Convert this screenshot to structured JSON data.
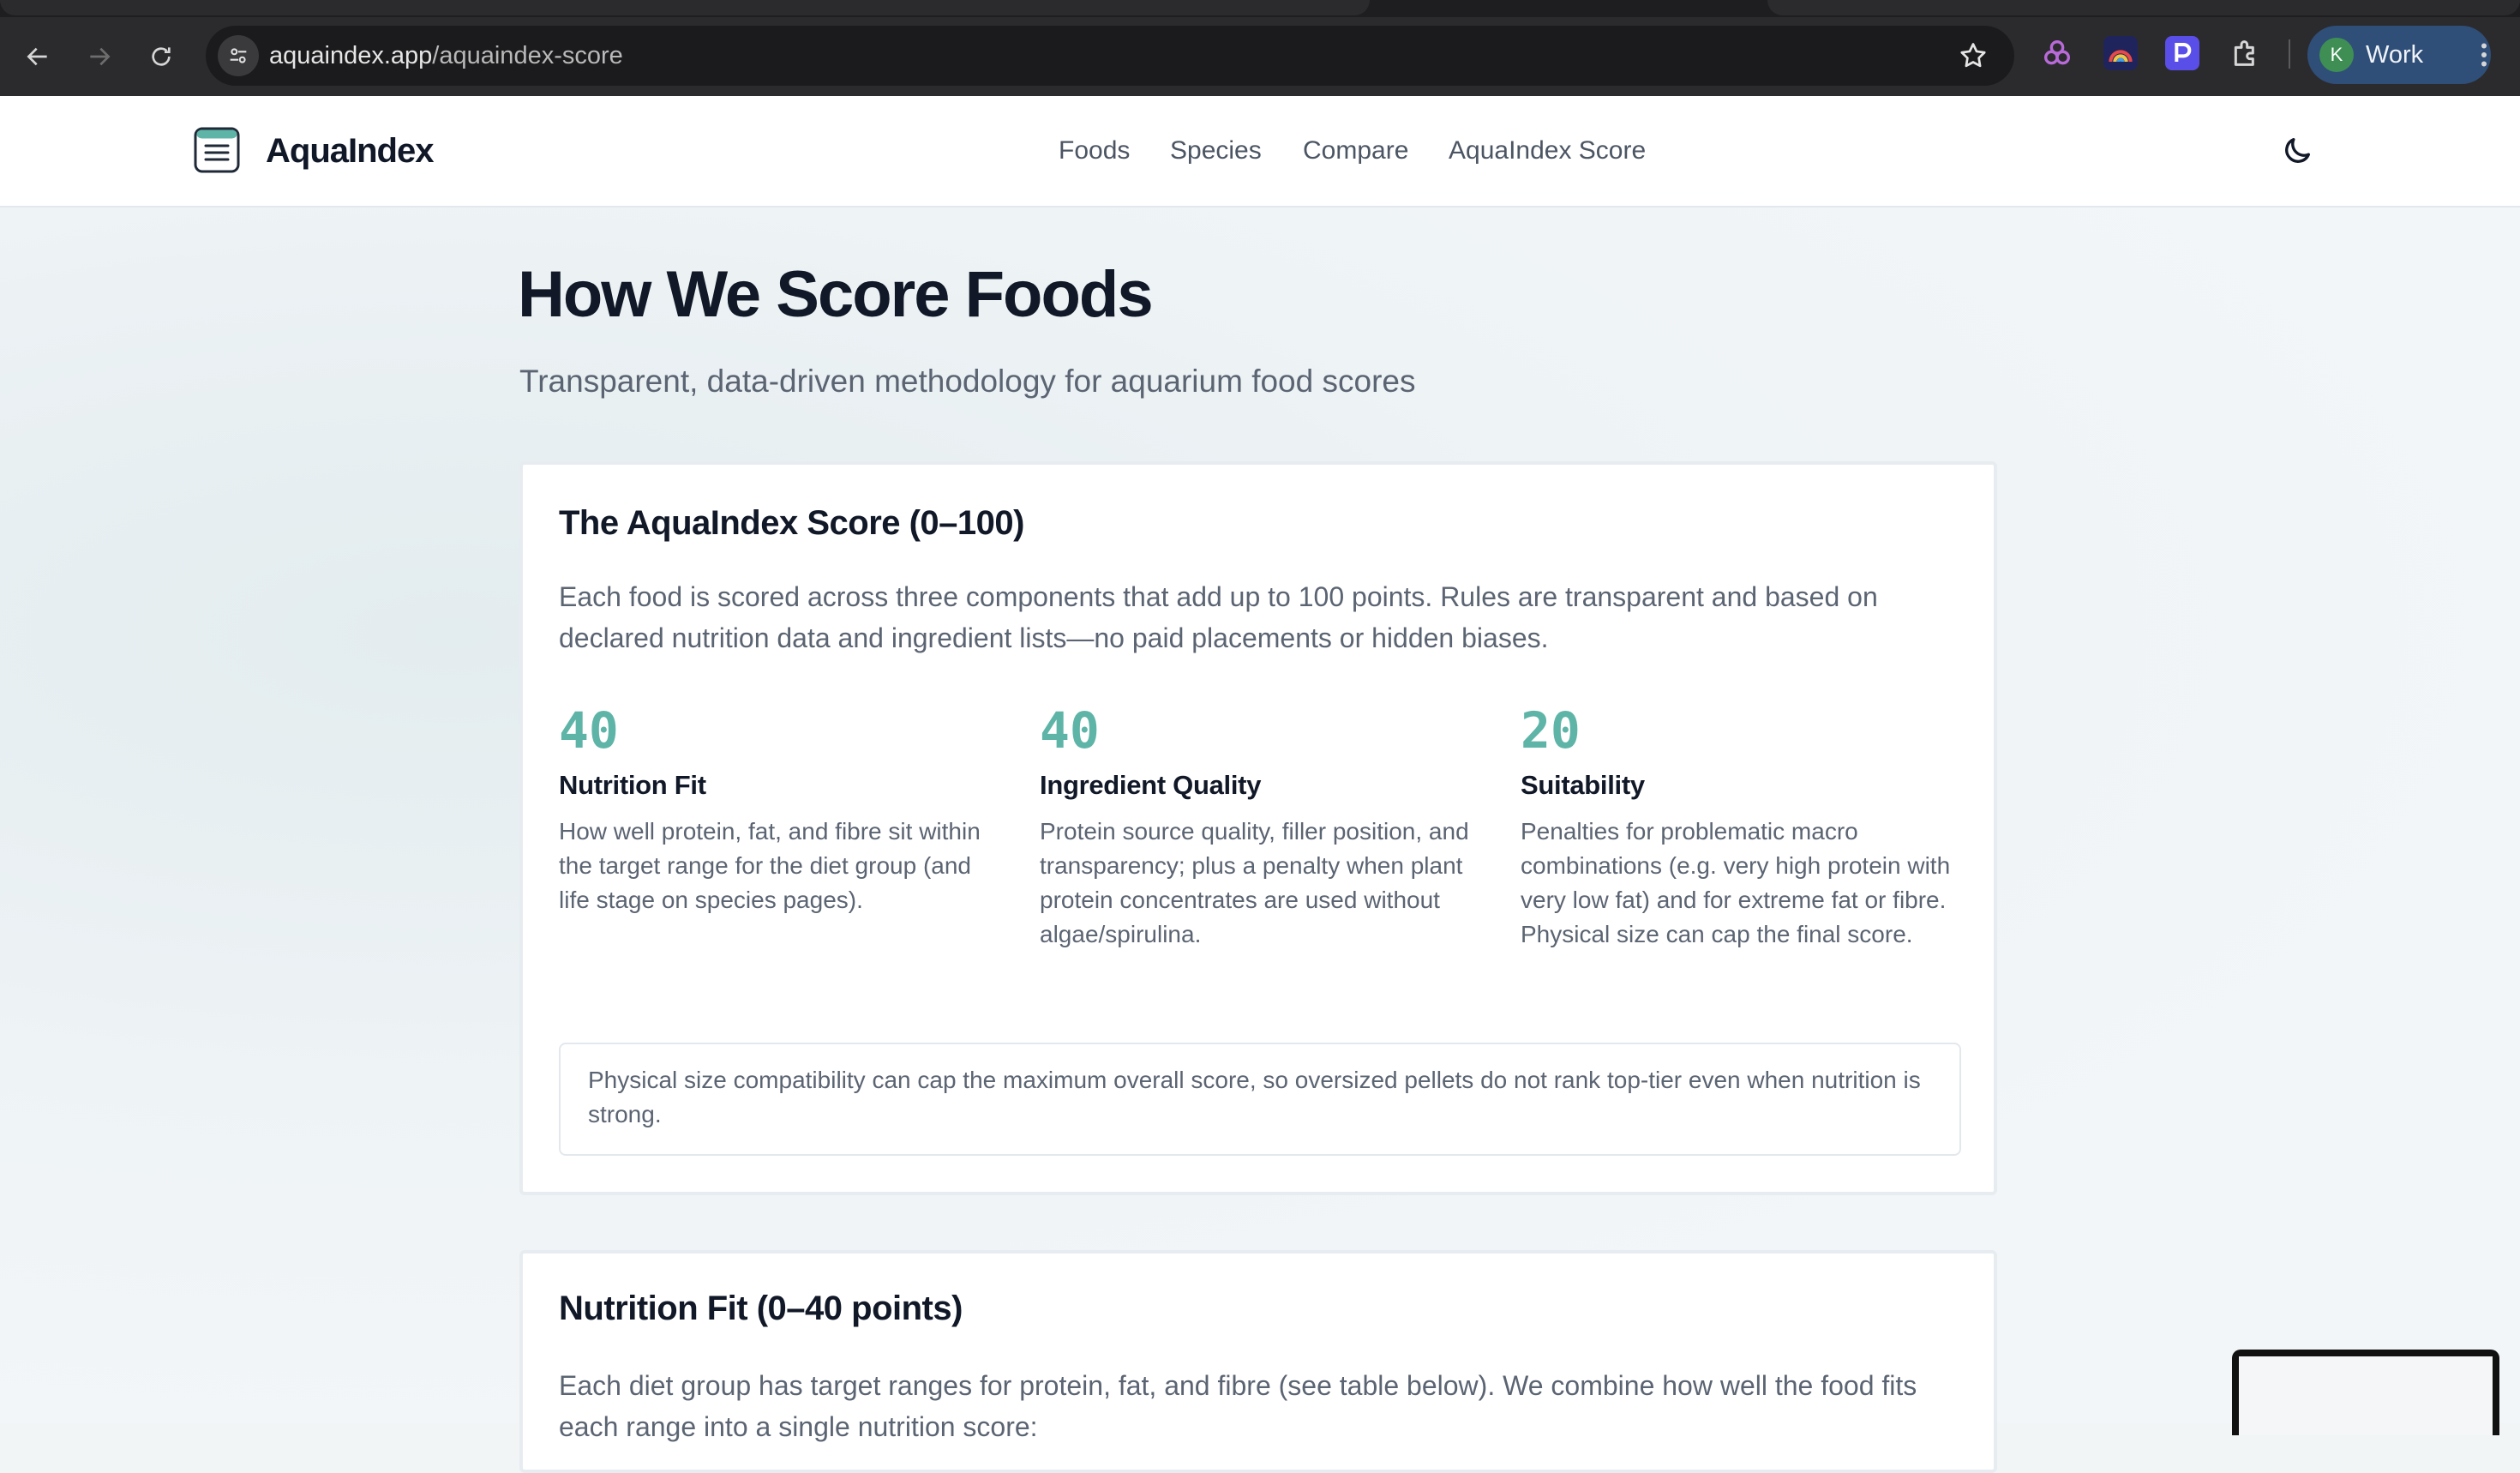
{
  "browser": {
    "url_host": "aquaindex.app",
    "url_path": "/aquaindex-score",
    "profile_initial": "K",
    "profile_name": "Work"
  },
  "header": {
    "brand": "AquaIndex",
    "nav": [
      {
        "label": "Foods"
      },
      {
        "label": "Species"
      },
      {
        "label": "Compare"
      },
      {
        "label": "AquaIndex Score"
      }
    ]
  },
  "page": {
    "title": "How We Score Foods",
    "subtitle": "Transparent, data-driven methodology for aquarium food scores"
  },
  "score_card": {
    "title": "The AquaIndex Score (0–100)",
    "intro": "Each food is scored across three components that add up to 100 points. Rules are transparent and based on declared nutrition data and ingredient lists—no paid placements or hidden biases.",
    "components": [
      {
        "points": "40",
        "name": "Nutrition Fit",
        "description": "How well protein, fat, and fibre sit within the target range for the diet group (and life stage on species pages)."
      },
      {
        "points": "40",
        "name": "Ingredient Quality",
        "description": "Protein source quality, filler position, and transparency; plus a penalty when plant protein concentrates are used without algae/spirulina."
      },
      {
        "points": "20",
        "name": "Suitability",
        "description": "Penalties for problematic macro combinations (e.g. very high protein with very low fat) and for extreme fat or fibre. Physical size can cap the final score."
      }
    ],
    "note": "Physical size compatibility can cap the maximum overall score, so oversized pellets do not rank top-tier even when nutrition is strong."
  },
  "nutrition_card": {
    "title": "Nutrition Fit (0–40 points)",
    "intro": "Each diet group has target ranges for protein, fat, and fibre (see table below). We combine how well the food fits each range into a single nutrition score:"
  },
  "colors": {
    "accent": "#5fb4a8",
    "text_dark": "#111827",
    "text_muted": "#5b6472"
  }
}
